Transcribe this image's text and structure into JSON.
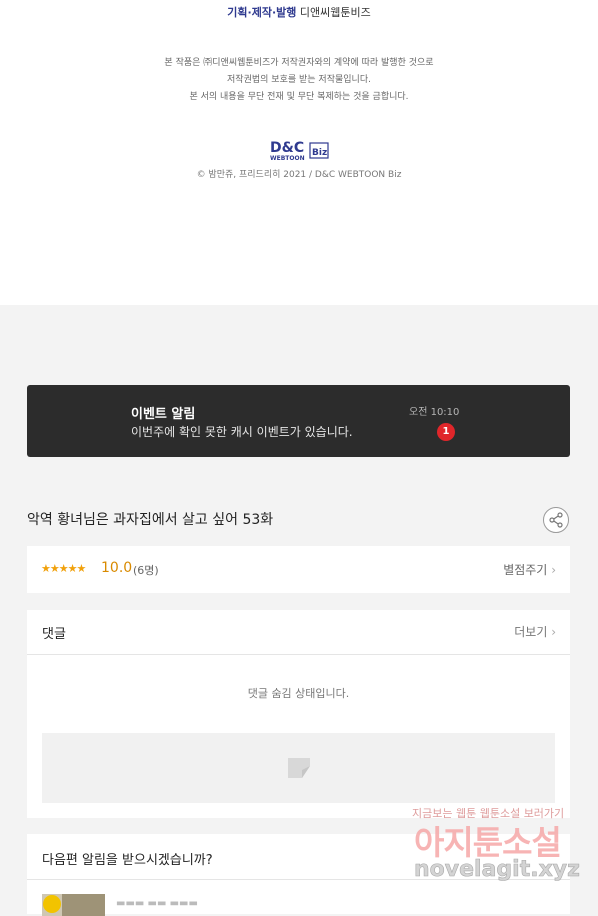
{
  "credits": {
    "production_label": "기획·제작·발행",
    "production_company": "디앤씨웹툰비즈",
    "notice_lines": [
      "본 작품은 ㈜디앤씨웹툰비즈가 저작권자와의 계약에 따라 발행한 것으로",
      "저작권법의 보호를 받는 저작물입니다.",
      "본 서의 내용을 무단 전재 및 무단 복제하는 것을 금합니다."
    ],
    "logo_text_main": "D&C",
    "logo_text_sub": "WEBTOON",
    "logo_text_biz": "Biz",
    "copyright": "© 밤만쥬, 프리드리히 2021 / D&C WEBTOON Biz"
  },
  "event": {
    "title": "이벤트 알림",
    "description": "이번주에 확인 못한 캐시 이벤트가 있습니다.",
    "time": "오전 10:10",
    "badge_count": "1"
  },
  "episode": {
    "title": "악역 황녀님은 과자집에서 살고 싶어 53화",
    "share_icon": "share-icon"
  },
  "rating": {
    "stars": "★★★★★",
    "score": "10.0",
    "count": "(6명)",
    "rate_label": "별점주기"
  },
  "comments": {
    "title": "댓글",
    "more_label": "더보기",
    "hidden_message": "댓글 숨김 상태입니다."
  },
  "next_alert": {
    "title": "다음편 알림을 받으시겠습니까?"
  },
  "watermark": {
    "line1": "지금보는 웹툰 웹툰소설 보러가기",
    "line2": "아지툰소설",
    "line3": "novelagit.xyz"
  },
  "colors": {
    "accent_rating": "#d98a00",
    "event_bg": "#2c2c2c",
    "badge_red": "#e0262a",
    "publisher_navy": "#2f3a8f"
  }
}
